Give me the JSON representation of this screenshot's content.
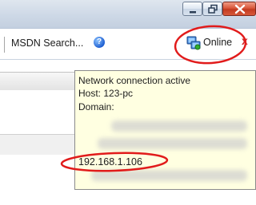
{
  "window": {
    "controls": [
      "minimize-icon",
      "maximize-icon",
      "close-icon"
    ]
  },
  "toolbar": {
    "msdn_search_label": "MSDN Search...",
    "help_icon": "help-icon",
    "help_glyph": "?",
    "online_icon": "network-status-icon",
    "online_label": "Online",
    "close_glyph": "x"
  },
  "tooltip": {
    "status": "Network connection active",
    "host": "Host: 123-pc",
    "domain": "Domain:",
    "ip": "192.168.1.106"
  },
  "colors": {
    "annotation": "#e11b1b",
    "tooltip_bg": "#ffffe1",
    "close_button": "#c23a20"
  }
}
